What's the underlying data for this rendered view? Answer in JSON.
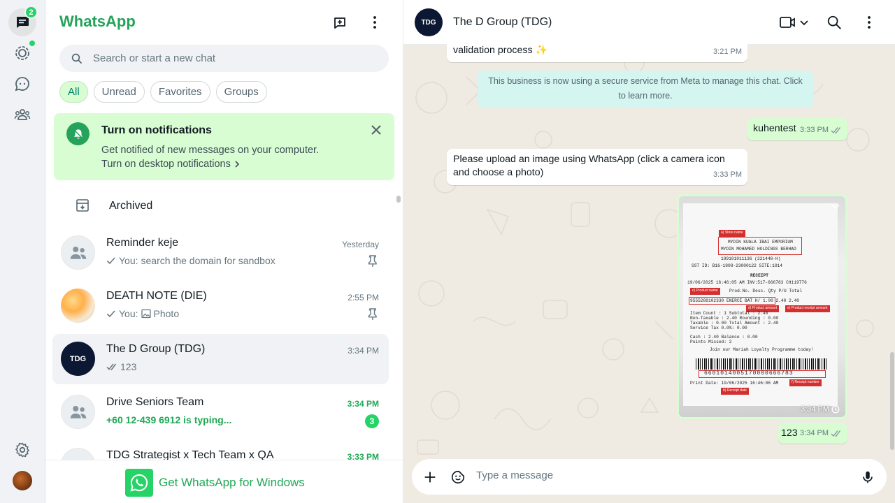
{
  "rail": {
    "chats_badge": "2"
  },
  "sidebar": {
    "brand": "WhatsApp",
    "search_placeholder": "Search or start a new chat",
    "filters": [
      "All",
      "Unread",
      "Favorites",
      "Groups"
    ],
    "notification": {
      "title": "Turn on notifications",
      "text": "Get notified of new messages on your computer.",
      "link": "Turn on desktop notifications"
    },
    "archived_label": "Archived",
    "chats": [
      {
        "name": "Reminder keje",
        "time": "Yesterday",
        "prefix": "You:",
        "preview": "search the domain for sandbox",
        "pinned": true
      },
      {
        "name": "DEATH NOTE (DIE)",
        "time": "2:55 PM",
        "prefix": "You:",
        "preview": "Photo",
        "pinned": true
      },
      {
        "name": "The D Group (TDG)",
        "time": "3:34 PM",
        "preview": "123"
      },
      {
        "name": "Drive Seniors Team",
        "time": "3:34 PM",
        "preview": "+60 12-439 6912 is typing...",
        "unread": "3"
      },
      {
        "name": "TDG Strategist x Tech Team x QA",
        "time": "3:33 PM"
      }
    ],
    "get_windows": "Get WhatsApp for Windows"
  },
  "chat": {
    "title": "The D Group (TDG)",
    "avatar_text": "TDG",
    "messages": [
      {
        "text": "validation process ✨",
        "time": "3:21 PM"
      },
      {
        "system": "This business is now using a secure service from Meta to manage this chat. Click to learn more."
      },
      {
        "text": "kuhentest",
        "time": "3:33 PM"
      },
      {
        "text": "Please upload an image using WhatsApp (click a camera icon and choose a photo)",
        "time": "3:33 PM"
      },
      {
        "image_time": "3:34 PM"
      },
      {
        "text": "123",
        "time": "3:34 PM"
      }
    ],
    "receipt": {
      "store": "MYDIN KUALA IBAI EMPORIUM",
      "company": "MYDIN MOHAMED HOLDINGS BERHAD",
      "reg": "199101011136  (221448-H)",
      "sst": "SST ID: B16-1808-23000122      SITE:1014",
      "receipt_label": "RECEIPT",
      "date_line": "19/06/2025 16:46:05 AM   INV:517-666783     CH119776",
      "header": "Prod.No.   Desc.       Qty    P/U    Total",
      "item": "9555289102330  ENERCE BAT H/   1.00   2.40   2.40",
      "totals1": "Item Count    : 1          Subtotal : 2.40",
      "totals2": "Non-Taxable   : 2.40       Rounding : 0.00",
      "totals3": "Taxable       : 0.00   Total Amount : 2.40",
      "totals4": "Service Tax 0.0%: 0.00",
      "cash": "Cash : 2.40                 Balance : 0.00",
      "points": "Points Missed:   2",
      "loyalty": "Join our Mariah Loyalty Programme today!",
      "barcode_number": "6601014005170000666783",
      "print_date": "Print Date: 19/06/2025 16:46:06 AM",
      "tags": {
        "store": "a) Store name",
        "product": "c) Product name",
        "amount": "d) Product amount",
        "receipt_amount": "e) Product receipt amount",
        "receipt_number": "f) Receipt number",
        "date": "b) Receipt date"
      }
    },
    "composer_placeholder": "Type a message"
  },
  "colors": {
    "brand_green": "#25a35a",
    "unread_green": "#25d366",
    "out_bubble": "#d9fdd3",
    "chat_bg": "#efeae2"
  }
}
